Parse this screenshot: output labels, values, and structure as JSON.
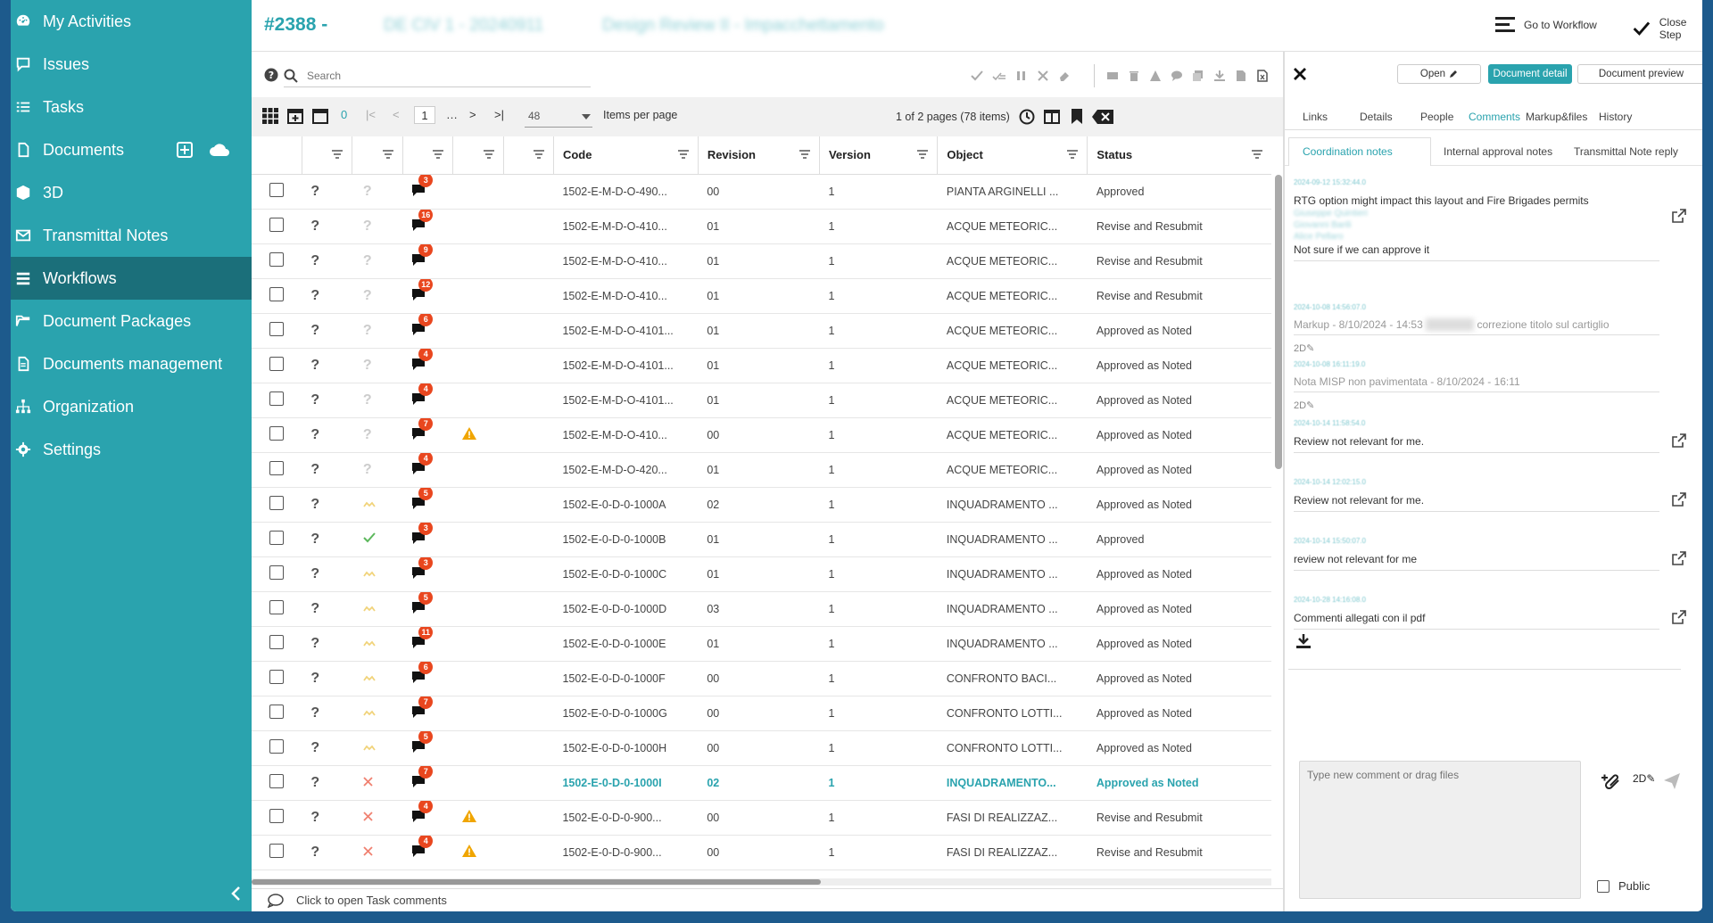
{
  "sidebar": {
    "items": [
      {
        "label": "My Activities",
        "icon": "dashboard-icon"
      },
      {
        "label": "Issues",
        "icon": "comment-icon"
      },
      {
        "label": "Tasks",
        "icon": "list-icon"
      },
      {
        "label": "Documents",
        "icon": "document-icon"
      },
      {
        "label": "3D",
        "icon": "cube-icon"
      },
      {
        "label": "Transmittal Notes",
        "icon": "envelope-icon"
      },
      {
        "label": "Workflows",
        "icon": "workflow-icon"
      },
      {
        "label": "Document Packages",
        "icon": "folder-open-icon"
      },
      {
        "label": "Documents management",
        "icon": "file-icon"
      },
      {
        "label": "Organization",
        "icon": "sitemap-icon"
      },
      {
        "label": "Settings",
        "icon": "gear-icon"
      }
    ],
    "active": "Workflows"
  },
  "header": {
    "id": "#2388 -",
    "code_blurred": "DE CIV 1 - 20240911",
    "title_blurred": "Design Review II - Impacchettamento",
    "go_to_workflow": "Go to Workflow",
    "close_step": "Close Step"
  },
  "search": {
    "placeholder": "Search"
  },
  "pager": {
    "current_page": "1",
    "zero": "0",
    "items_per_page_value": "48",
    "items_per_page_label": "Items per page",
    "pages_info": "1 of 2 pages (78 items)"
  },
  "table": {
    "headers": {
      "code": "Code",
      "revision": "Revision",
      "version": "Version",
      "object": "Object",
      "status": "Status"
    },
    "rows": [
      {
        "badge": "3",
        "q2": "?",
        "warn": false,
        "code": "1502-E-M-D-O-490...",
        "revision": "00",
        "version": "1",
        "object": "PIANTA ARGINELLI ...",
        "status": "Approved"
      },
      {
        "badge": "16",
        "q2": "?",
        "warn": false,
        "code": "1502-E-M-D-O-410...",
        "revision": "01",
        "version": "1",
        "object": "ACQUE METEORIC...",
        "status": "Revise and Resubmit"
      },
      {
        "badge": "9",
        "q2": "?",
        "warn": false,
        "code": "1502-E-M-D-O-410...",
        "revision": "01",
        "version": "1",
        "object": "ACQUE METEORIC...",
        "status": "Revise and Resubmit"
      },
      {
        "badge": "12",
        "q2": "?",
        "warn": false,
        "code": "1502-E-M-D-O-410...",
        "revision": "01",
        "version": "1",
        "object": "ACQUE METEORIC...",
        "status": "Revise and Resubmit"
      },
      {
        "badge": "6",
        "q2": "?",
        "warn": false,
        "code": "1502-E-M-D-O-4101...",
        "revision": "01",
        "version": "1",
        "object": "ACQUE METEORIC...",
        "status": "Approved as Noted"
      },
      {
        "badge": "4",
        "q2": "?",
        "warn": false,
        "code": "1502-E-M-D-O-4101...",
        "revision": "01",
        "version": "1",
        "object": "ACQUE METEORIC...",
        "status": "Approved as Noted"
      },
      {
        "badge": "4",
        "q2": "?",
        "warn": false,
        "code": "1502-E-M-D-O-4101...",
        "revision": "01",
        "version": "1",
        "object": "ACQUE METEORIC...",
        "status": "Approved as Noted"
      },
      {
        "badge": "7",
        "q2": "?",
        "warn": true,
        "code": "1502-E-M-D-O-410...",
        "revision": "00",
        "version": "1",
        "object": "ACQUE METEORIC...",
        "status": "Approved as Noted"
      },
      {
        "badge": "4",
        "q2": "?",
        "warn": false,
        "code": "1502-E-M-D-O-420...",
        "revision": "01",
        "version": "1",
        "object": "ACQUE METEORIC...",
        "status": "Approved as Noted"
      },
      {
        "badge": "5",
        "q2": "thumb",
        "warn": false,
        "code": "1502-E-0-D-0-1000A",
        "revision": "02",
        "version": "1",
        "object": "INQUADRAMENTO ...",
        "status": "Approved as Noted"
      },
      {
        "badge": "3",
        "q2": "check",
        "warn": false,
        "code": "1502-E-0-D-0-1000B",
        "revision": "01",
        "version": "1",
        "object": "INQUADRAMENTO ...",
        "status": "Approved"
      },
      {
        "badge": "3",
        "q2": "thumb",
        "warn": false,
        "code": "1502-E-0-D-0-1000C",
        "revision": "01",
        "version": "1",
        "object": "INQUADRAMENTO ...",
        "status": "Approved as Noted"
      },
      {
        "badge": "5",
        "q2": "thumb",
        "warn": false,
        "code": "1502-E-0-D-0-1000D",
        "revision": "03",
        "version": "1",
        "object": "INQUADRAMENTO ...",
        "status": "Approved as Noted"
      },
      {
        "badge": "11",
        "q2": "thumb",
        "warn": false,
        "code": "1502-E-0-D-0-1000E",
        "revision": "01",
        "version": "1",
        "object": "INQUADRAMENTO ...",
        "status": "Approved as Noted"
      },
      {
        "badge": "6",
        "q2": "thumb",
        "warn": false,
        "code": "1502-E-0-D-0-1000F",
        "revision": "00",
        "version": "1",
        "object": "CONFRONTO BACI...",
        "status": "Approved as Noted"
      },
      {
        "badge": "7",
        "q2": "thumb",
        "warn": false,
        "code": "1502-E-0-D-0-1000G",
        "revision": "00",
        "version": "1",
        "object": "CONFRONTO LOTTI...",
        "status": "Approved as Noted"
      },
      {
        "badge": "5",
        "q2": "thumb",
        "warn": false,
        "code": "1502-E-0-D-0-1000H",
        "revision": "00",
        "version": "1",
        "object": "CONFRONTO LOTTI...",
        "status": "Approved as Noted"
      },
      {
        "badge": "7",
        "q2": "cross",
        "warn": false,
        "code": "1502-E-0-D-0-1000I",
        "revision": "02",
        "version": "1",
        "object": "INQUADRAMENTO...",
        "status": "Approved as Noted",
        "highlight": true
      },
      {
        "badge": "4",
        "q2": "cross",
        "warn": true,
        "code": "1502-E-0-D-0-900...",
        "revision": "00",
        "version": "1",
        "object": "FASI DI REALIZZAZ...",
        "status": "Revise and Resubmit"
      },
      {
        "badge": "4",
        "q2": "cross",
        "warn": true,
        "code": "1502-E-0-D-0-900...",
        "revision": "00",
        "version": "1",
        "object": "FASI DI REALIZZAZ...",
        "status": "Revise and Resubmit"
      }
    ]
  },
  "footer": {
    "task_comments": "Click to open Task comments"
  },
  "right_panel": {
    "buttons": {
      "open": "Open",
      "document_detail": "Document detail",
      "document_preview": "Document preview"
    },
    "tabs": [
      "Links",
      "Details",
      "People",
      "Comments",
      "Markup&files",
      "History"
    ],
    "active_tab": "Comments",
    "subtabs": [
      "Coordination notes",
      "Internal approval notes",
      "Transmittal Note reply"
    ],
    "active_subtab": "Coordination notes",
    "comments": [
      {
        "meta": "2024-09-12 15:32:44.0",
        "text": "RTG option might impact this layout and Fire Brigades permits",
        "mentions": [
          "Giuseppe Quintieri",
          "Giovanni Barili",
          "Alice Pellaro"
        ],
        "text2": "Not sure if we can approve it",
        "ext": true
      },
      {
        "meta": "2024-10-08 14:56:07.0",
        "grey": "Markup - 8/10/2024 - 14:53",
        "grey_after": "correzione titolo sul cartiglio",
        "tag": "2D",
        "ext": false
      },
      {
        "meta": "2024-10-08 16:11:19.0",
        "grey": "Nota MISP non pavimentata - 8/10/2024 - 16:11",
        "tag": "2D",
        "ext": false
      },
      {
        "meta": "2024-10-14 11:58:54.0",
        "text": "Review not relevant for me.",
        "ext": true
      },
      {
        "meta": "2024-10-14 12:02:15.0",
        "text": "Review not relevant for me.",
        "ext": true
      },
      {
        "meta": "2024-10-14 15:50:07.0",
        "text": "review not relevant for me",
        "ext": true
      },
      {
        "meta": "2024-10-28 14:16:08.0",
        "text": "Commenti allegati con il pdf",
        "ext": true
      }
    ],
    "composer": {
      "placeholder": "Type new comment or drag files",
      "public_label": "Public",
      "tag": "2D"
    }
  },
  "colors": {
    "accent": "#2aa3ae",
    "sidebar": "#2aa3ae",
    "sidebar_active": "#1b6f7a",
    "badge": "#e9471f",
    "warning": "#f0a500",
    "frame": "#1d5a8c"
  }
}
